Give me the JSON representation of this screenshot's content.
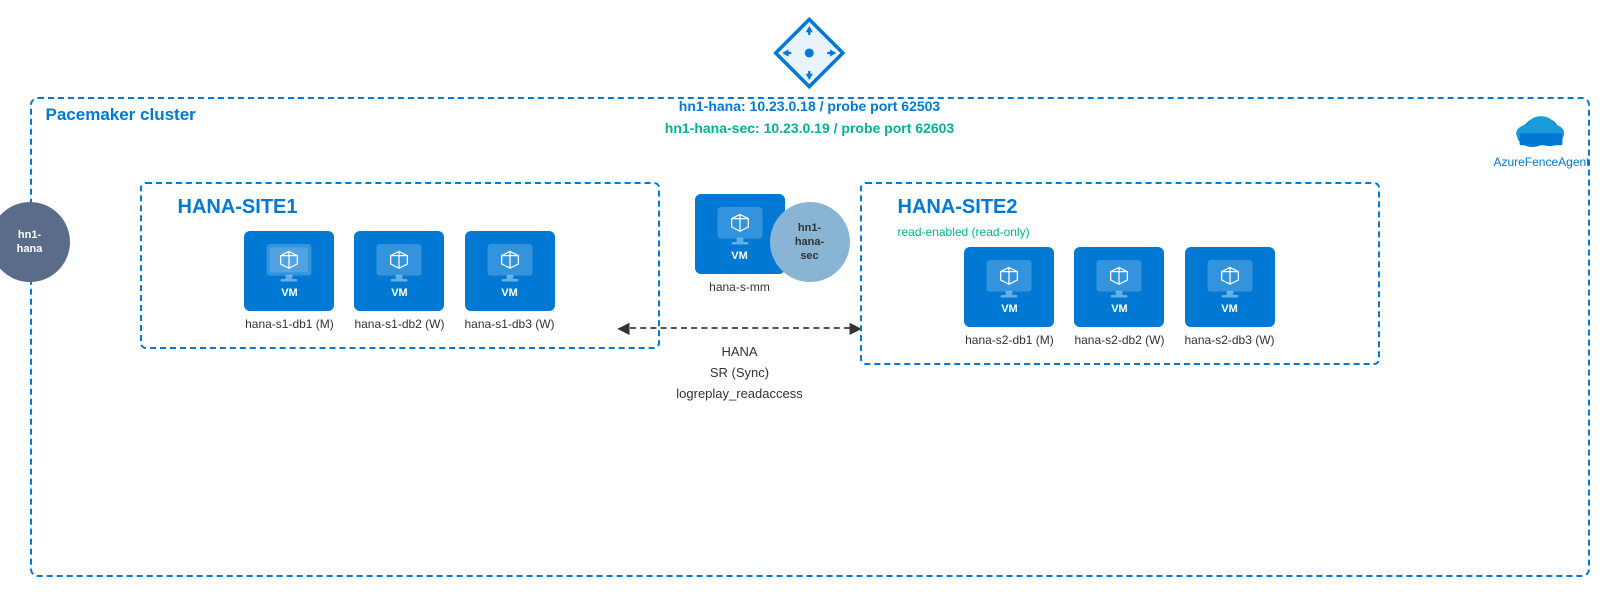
{
  "diagram": {
    "title": "Pacemaker cluster",
    "loadBalancer": {
      "primaryLabel": "hn1-hana:  10.23.0.18 / probe port 62503",
      "secondaryLabel": "hn1-hana-sec:  10.23.0.19 / probe port 62603"
    },
    "fenceAgent": {
      "label": "AzureFenceAgent"
    },
    "site1": {
      "name": "HANA-SITE1",
      "vip": "hn1-\nhana",
      "vms": [
        {
          "name": "hana-s1-db1 (M)"
        },
        {
          "name": "hana-s1-db2 (W)"
        },
        {
          "name": "hana-s1-db3 (W)"
        }
      ]
    },
    "middleVM": {
      "name": "hana-s-mm"
    },
    "site2": {
      "name": "HANA-SITE2",
      "vip": "hn1-\nhana-\nsec",
      "readLabel": "read-enabled (read-only)",
      "vms": [
        {
          "name": "hana-s2-db1 (M)"
        },
        {
          "name": "hana-s2-db2 (W)"
        },
        {
          "name": "hana-s2-db3 (W)"
        }
      ]
    },
    "srSync": {
      "label1": "HANA",
      "label2": "SR (Sync)",
      "label3": "logreplay_readaccess"
    }
  }
}
